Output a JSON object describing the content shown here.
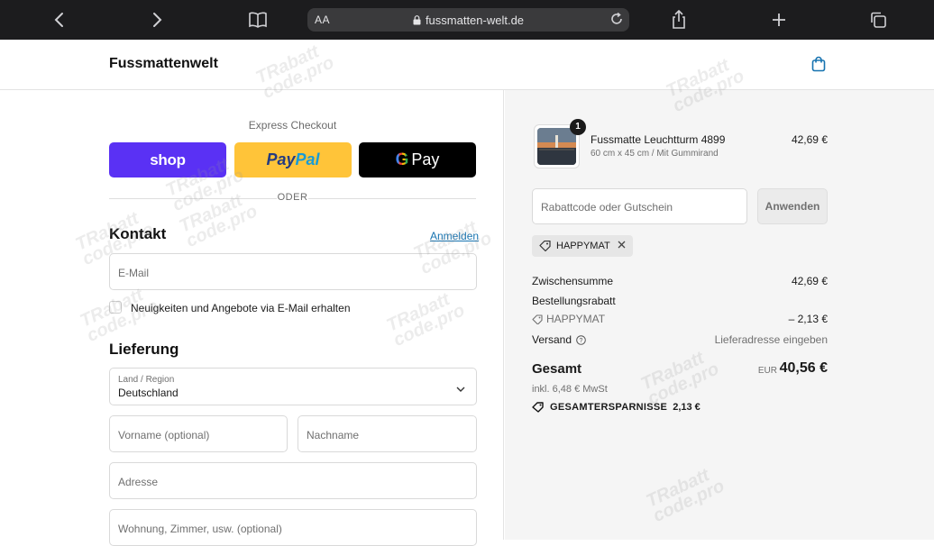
{
  "browser": {
    "url_aa": "AA",
    "url_host": "fussmatten-welt.de",
    "icons": [
      "back-icon",
      "forward-icon",
      "bookmarks-icon",
      "lock-icon",
      "reload-icon",
      "share-icon",
      "new-tab-icon",
      "tabs-icon"
    ]
  },
  "header": {
    "shop_name": "Fussmattenwelt",
    "cart_icon": "shopping-bag-icon"
  },
  "checkout": {
    "express_title": "Express Checkout",
    "shop_pay_label": "shop",
    "paypal_label_1": "Pay",
    "paypal_label_2": "Pal",
    "gpay_g": "G",
    "gpay_label": "Pay",
    "oder": "ODER",
    "contact_title": "Kontakt",
    "login_link": "Anmelden",
    "email_placeholder": "E-Mail",
    "newsletter_label": "Neuigkeiten und Angebote via E-Mail erhalten",
    "delivery_title": "Lieferung",
    "country_label": "Land / Region",
    "country_value": "Deutschland",
    "firstname_placeholder": "Vorname (optional)",
    "lastname_placeholder": "Nachname",
    "address_placeholder": "Adresse",
    "apartment_placeholder": "Wohnung, Zimmer, usw. (optional)"
  },
  "summary": {
    "item_quantity": "1",
    "item_name": "Fussmatte Leuchtturm 4899",
    "item_variant": "60 cm x 45 cm / Mit Gummirand",
    "item_price": "42,69 €",
    "discount_placeholder": "Rabattcode oder Gutschein",
    "apply_label": "Anwenden",
    "applied_code": "HAPPYMAT",
    "subtotal_label": "Zwischensumme",
    "subtotal_value": "42,69 €",
    "order_discount_label": "Bestellungsrabatt",
    "order_discount_code": "HAPPYMAT",
    "order_discount_value": "– 2,13 €",
    "shipping_label": "Versand",
    "shipping_value": "Lieferadresse eingeben",
    "total_label": "Gesamt",
    "total_currency": "EUR",
    "total_value": "40,56 €",
    "vat_text": "inkl. 6,48 € MwSt",
    "savings_label": "GESAMTERSPARNISSE",
    "savings_value": "2,13 €"
  },
  "watermark": {
    "text_1": "TRabatt",
    "text_2": "code.pro"
  },
  "colors": {
    "shop_pay": "#5a31f4",
    "paypal": "#ffc439",
    "link": "#1773b0",
    "browser_bar": "#1c1c1e",
    "summary_bg": "#f5f5f5"
  }
}
